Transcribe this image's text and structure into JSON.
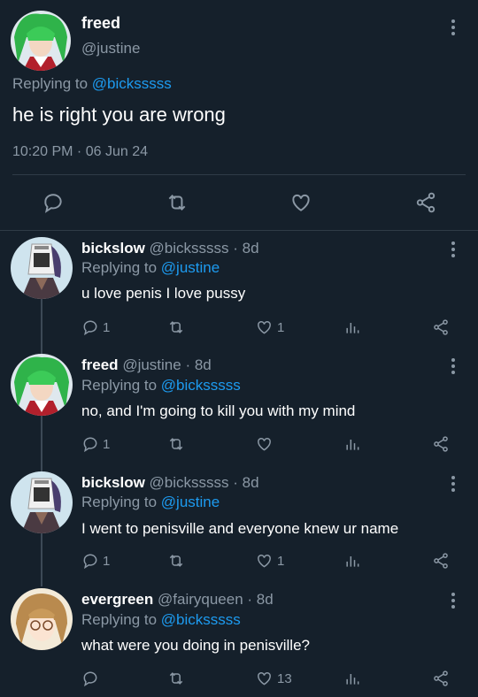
{
  "main_tweet": {
    "display_name": "freed",
    "handle": "@justine",
    "replying_prefix": "Replying to",
    "replying_handle": "@bicksssss",
    "text": "he is right you are wrong",
    "timestamp": "10:20 PM · 06 Jun 24"
  },
  "replies": [
    {
      "display_name": "bickslow",
      "handle": "@bicksssss",
      "age": "· 8d",
      "replying_prefix": "Replying to",
      "replying_handle": "@justine",
      "text": "u love penis I love pussy",
      "reply_count": "1",
      "like_count": "1"
    },
    {
      "display_name": "freed",
      "handle": "@justine",
      "age": "· 8d",
      "replying_prefix": "Replying to",
      "replying_handle": "@bicksssss",
      "text": "no, and I'm going to kill you with my mind",
      "reply_count": "1",
      "like_count": ""
    },
    {
      "display_name": "bickslow",
      "handle": "@bicksssss",
      "age": "· 8d",
      "replying_prefix": "Replying to",
      "replying_handle": "@justine",
      "text": "I went to penisville and everyone knew ur name",
      "reply_count": "1",
      "like_count": "1"
    },
    {
      "display_name": "evergreen",
      "handle": "@fairyqueen",
      "age": "· 8d",
      "replying_prefix": "Replying to",
      "replying_handle": "@bicksssss",
      "text": "what were you doing in penisville?",
      "reply_count": "",
      "like_count": "13"
    }
  ],
  "colors": {
    "background": "#15202b",
    "link": "#1d9bf0",
    "muted": "#8b98a5"
  }
}
